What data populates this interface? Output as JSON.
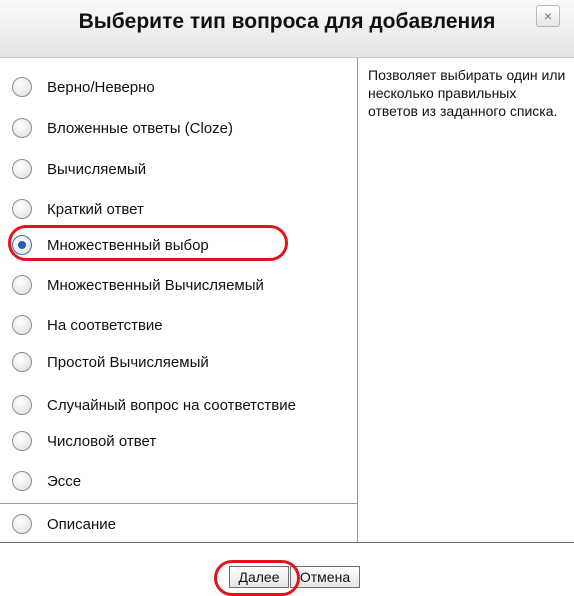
{
  "dialog": {
    "title": "Выберите тип вопроса для добавления",
    "close_label": "×"
  },
  "options": [
    {
      "label": "Верно/Неверно",
      "checked": false
    },
    {
      "label": "Вложенные ответы (Cloze)",
      "checked": false
    },
    {
      "label": "Вычисляемый",
      "checked": false
    },
    {
      "label": "Краткий ответ",
      "checked": false
    },
    {
      "label": "Множественный выбор",
      "checked": true
    },
    {
      "label": "Множественный Вычисляемый",
      "checked": false
    },
    {
      "label": "На соответствие",
      "checked": false
    },
    {
      "label": "Простой Вычисляемый",
      "checked": false
    },
    {
      "label": "Случайный вопрос на соответствие",
      "checked": false
    },
    {
      "label": "Числовой ответ",
      "checked": false
    },
    {
      "label": "Эссе",
      "checked": false
    },
    {
      "label": "Описание",
      "checked": false
    }
  ],
  "description": "Позволяет выбирать один или несколько правильных ответов из заданного списка.",
  "buttons": {
    "next_label": "Далее",
    "cancel_label": "Отмена"
  },
  "colors": {
    "highlight": "#e2141c",
    "radio_selected": "#1d5fb8"
  }
}
